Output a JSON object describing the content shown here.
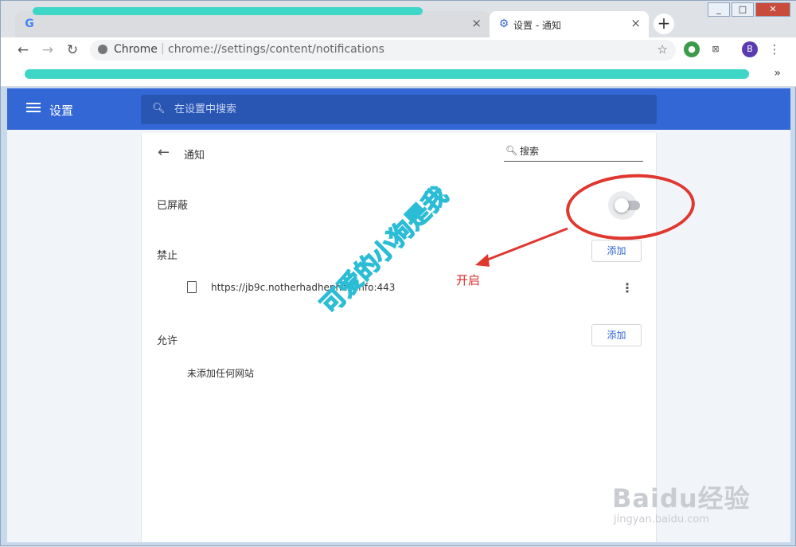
{
  "browser": {
    "tabs": [
      {
        "title": "",
        "state": "inactive",
        "icon": "google-icon"
      },
      {
        "title": "",
        "state": "inactive",
        "icon": ""
      },
      {
        "title": "",
        "state": "inactive",
        "icon": ""
      },
      {
        "title": "设置 - 通知",
        "state": "active",
        "icon": "settings-gear-icon"
      }
    ],
    "new_tab": "+",
    "address": {
      "site_label": "Chrome",
      "separator": "|",
      "url": "chrome://settings/content/notifications"
    },
    "profile_initial": "B",
    "bookmarks_more": "»"
  },
  "settings": {
    "header_title": "设置",
    "search_placeholder": "在设置中搜索"
  },
  "page": {
    "title": "通知",
    "search_placeholder": "搜索",
    "blocked_label": "已屏蔽",
    "blocked_toggle_on": false,
    "block_section": "禁止",
    "add_label": "添加",
    "blocked_sites": [
      "https://jb9c.notherhadhenhec.info:443"
    ],
    "allow_section": "允许",
    "allow_empty": "未添加任何网站"
  },
  "annotation": {
    "label": "开启",
    "watermark": "可爱的小狗是我",
    "colors": {
      "red": "#e0372f",
      "cyan": "#2bbcd6"
    }
  },
  "source_watermark": {
    "brand": "Baidu经验",
    "url": "jingyan.baidu.com"
  },
  "colors": {
    "accent": "#3367d6",
    "header": "#3367d6",
    "search_bg": "#2a56b3"
  }
}
